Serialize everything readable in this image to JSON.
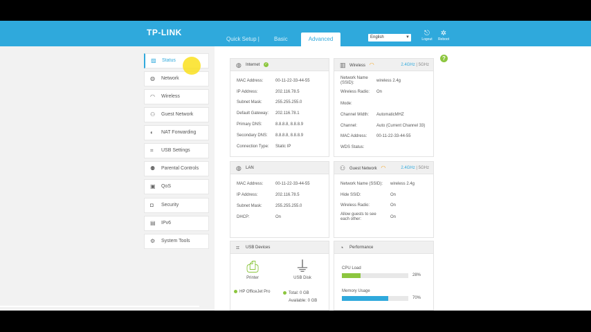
{
  "brand": "TP-LINK",
  "nav": {
    "quick_setup": "Quick Setup  |",
    "basic": "Basic",
    "advanced": "Advanced"
  },
  "language": {
    "selected": "English"
  },
  "top_actions": {
    "logout": "Logout",
    "reboot": "Reboot"
  },
  "sidebar": {
    "items": [
      {
        "label": "Status",
        "icon": "status-chart-icon",
        "active": true
      },
      {
        "label": "Network",
        "icon": "globe-icon"
      },
      {
        "label": "Wireless",
        "icon": "wifi-icon"
      },
      {
        "label": "Guest Network",
        "icon": "guests-icon"
      },
      {
        "label": "NAT Forwarding",
        "icon": "nat-icon"
      },
      {
        "label": "USB Settings",
        "icon": "usb-icon"
      },
      {
        "label": "Parental Controls",
        "icon": "parental-icon"
      },
      {
        "label": "QoS",
        "icon": "qos-icon"
      },
      {
        "label": "Security",
        "icon": "lock-icon"
      },
      {
        "label": "IPv6",
        "icon": "ipv6-icon"
      },
      {
        "label": "System Tools",
        "icon": "gear-icon"
      }
    ]
  },
  "help": "?",
  "internet": {
    "title": "Internet",
    "rows": [
      {
        "label": "MAC Address:",
        "value": "00-11-22-33-44-55"
      },
      {
        "label": "IP Address:",
        "value": "202.116.78.5"
      },
      {
        "label": "Subnet Mask:",
        "value": "255.255.255.0"
      },
      {
        "label": "Default Gateway:",
        "value": "202.116.78.1"
      },
      {
        "label": "Primary DNS:",
        "value": "8.8.8.8, 8.8.8.9"
      },
      {
        "label": "Secondary DNS:",
        "value": "8.8.8.8, 8.8.8.9"
      },
      {
        "label": "Connection Type:",
        "value": "Static IP"
      }
    ]
  },
  "wireless": {
    "title": "Wireless",
    "band_24": "2.4GHz",
    "sep": "|",
    "band_5": "5GHz",
    "rows": [
      {
        "label": "Network Name (SSID):",
        "value": "wireless 2.4g"
      },
      {
        "label": "Wireless Radio:",
        "value": "On"
      },
      {
        "label": "Mode:",
        "value": ""
      },
      {
        "label": "Channel Width:",
        "value": "AutomaticMHZ"
      },
      {
        "label": "Channel:",
        "value": "Auto (Current Channel 33)"
      },
      {
        "label": "MAC Address:",
        "value": "00-11-22-33-44-55"
      },
      {
        "label": "WDS Status:",
        "value": ""
      }
    ]
  },
  "lan": {
    "title": "LAN",
    "rows": [
      {
        "label": "MAC Address:",
        "value": "00-11-22-33-44-55"
      },
      {
        "label": "IP Address:",
        "value": "202.116.78.5"
      },
      {
        "label": "Subnet Mask:",
        "value": "255.255.255.0"
      },
      {
        "label": "DHCP:",
        "value": "On"
      }
    ]
  },
  "guest": {
    "title": "Guest Network",
    "band_24": "2.4GHz",
    "sep": "|",
    "band_5": "5GHz",
    "rows": [
      {
        "label": "Network Name (SSID):",
        "value": "wireless 2.4g"
      },
      {
        "label": "Hide SSID:",
        "value": "On"
      },
      {
        "label": "Wireless Radio:",
        "value": "On"
      },
      {
        "label": "Allow guests to see each other:",
        "value": "On"
      }
    ]
  },
  "usb": {
    "title": "USB Devices",
    "printer_label": "Printer",
    "printer_name": "HP OfficeJet Pro",
    "disk_label": "USB Disk",
    "total": "Total:  0 GB",
    "available": "Available:  0 GB"
  },
  "performance": {
    "title": "Performance",
    "cpu_label": "CPU Load",
    "cpu_value": 28,
    "cpu_text": "28%",
    "mem_label": "Memory Usage",
    "mem_value": 70,
    "mem_text": "70%"
  },
  "colors": {
    "accent": "#2fa9dc",
    "ok": "#8cc63f",
    "wifi": "#f5a623"
  }
}
